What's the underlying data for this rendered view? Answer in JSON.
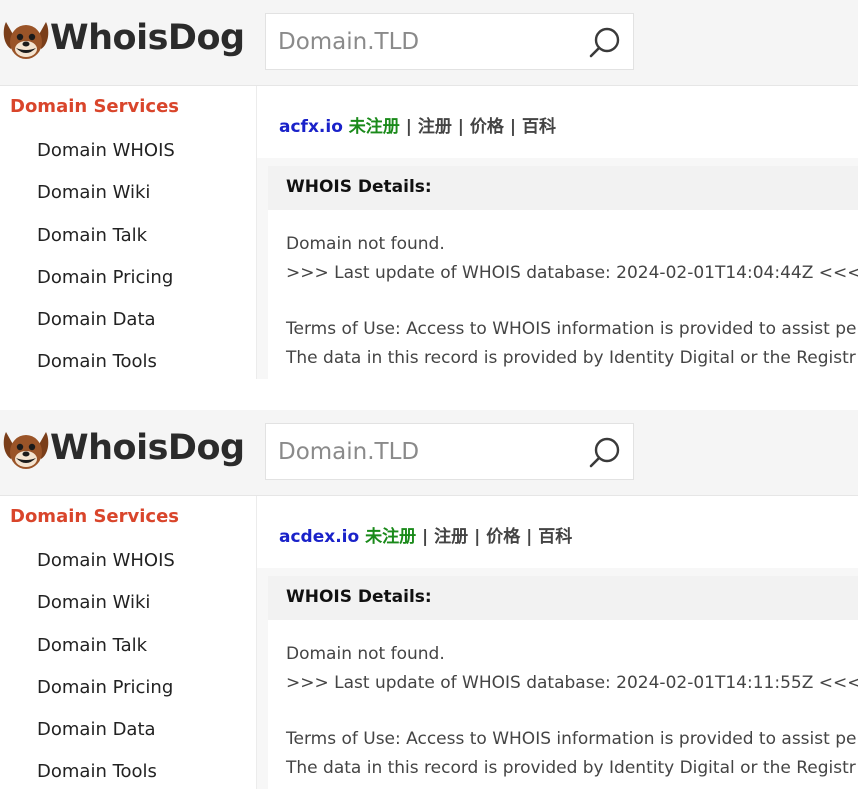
{
  "shots": [
    {
      "logo_text": "WhoisDog",
      "search_placeholder": "Domain.TLD",
      "sidebar_title": "Domain Services",
      "sidebar_items": [
        "Domain WHOIS",
        "Domain Wiki",
        "Domain Talk",
        "Domain Pricing",
        "Domain Data",
        "Domain Tools"
      ],
      "domain": "acfx.io",
      "status": "未注册",
      "sep": "|",
      "links": [
        "注册",
        "价格",
        "百科"
      ],
      "details_title": "WHOIS Details:",
      "lines": [
        "Domain not found.",
        ">>> Last update of WHOIS database: 2024-02-01T14:04:44Z <<<",
        "Terms of Use: Access to WHOIS information is provided to assist pe",
        "The data in this record is provided by Identity Digital or the Registr"
      ]
    },
    {
      "logo_text": "WhoisDog",
      "search_placeholder": "Domain.TLD",
      "sidebar_title": "Domain Services",
      "sidebar_items": [
        "Domain WHOIS",
        "Domain Wiki",
        "Domain Talk",
        "Domain Pricing",
        "Domain Data",
        "Domain Tools"
      ],
      "domain": "acdex.io",
      "status": "未注册",
      "sep": "|",
      "links": [
        "注册",
        "价格",
        "百科"
      ],
      "details_title": "WHOIS Details:",
      "lines": [
        "Domain not found.",
        ">>> Last update of WHOIS database: 2024-02-01T14:11:55Z <<<",
        "Terms of Use: Access to WHOIS information is provided to assist pe",
        "The data in this record is provided by Identity Digital or the Registr"
      ]
    }
  ],
  "colors": {
    "brand_red": "#d9452b",
    "domain_blue": "#1a22c9",
    "status_green": "#1a8a1a",
    "dog_brown": "#8b4a22"
  },
  "icons": {
    "logo": "dog-face-icon",
    "search": "magnifier-icon"
  }
}
